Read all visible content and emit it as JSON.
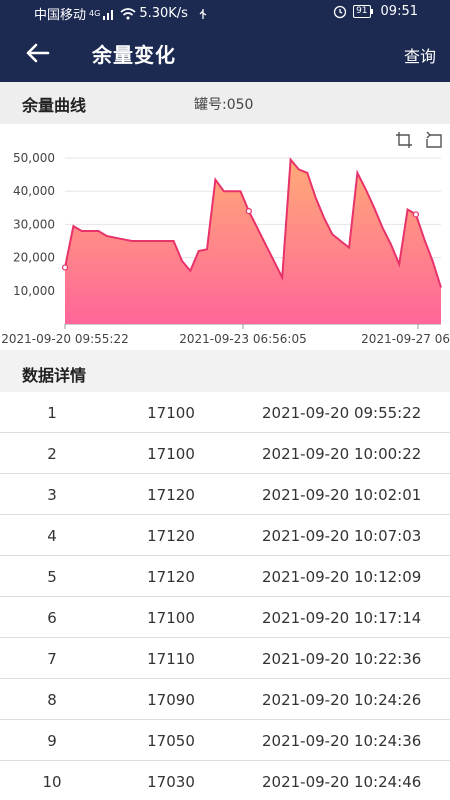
{
  "status_bar": {
    "carrier": "中国移动",
    "network": "4G",
    "speed": "5.30K/s",
    "battery": "91",
    "time": "09:51"
  },
  "header": {
    "back_icon": "arrow-left-icon",
    "title": "余量变化",
    "query_label": "查询"
  },
  "subheader": {
    "label": "余量曲线",
    "tank_label": "罐号:050"
  },
  "chart_data": {
    "type": "area",
    "title": "",
    "xlabel": "",
    "ylabel": "",
    "ylim": [
      0,
      50000
    ],
    "yticks": [
      "10,000",
      "20,000",
      "30,000",
      "40,000",
      "50,000"
    ],
    "xticks": [
      "2021-09-20 09:55:22",
      "2021-09-23 06:56:05",
      "2021-09-27 06"
    ],
    "grid": true,
    "fill_gradient": [
      "#ffaa77",
      "#ff6699"
    ],
    "line_color": "#e8326a",
    "series": [
      {
        "values": [
          17000,
          29500,
          28000,
          28000,
          28000,
          26500,
          26000,
          25500,
          25000,
          25000,
          25000,
          25000,
          25000,
          25000,
          19000,
          16000,
          22000,
          22500,
          43500,
          40000,
          40000,
          40000,
          34000,
          29000,
          24000,
          19000,
          14000,
          49500,
          46500,
          45500,
          38000,
          32000,
          27000,
          25000,
          23000,
          45500,
          40500,
          35000,
          29000,
          24000,
          18000,
          34500,
          33000,
          25500,
          19000,
          11000
        ]
      }
    ]
  },
  "chart_tools": {
    "zoom_icon": "crop-zoom-icon",
    "reset_icon": "restore-icon"
  },
  "section": {
    "title": "数据详情"
  },
  "table": {
    "rows": [
      {
        "idx": "1",
        "value": "17100",
        "time": "2021-09-20 09:55:22"
      },
      {
        "idx": "2",
        "value": "17100",
        "time": "2021-09-20 10:00:22"
      },
      {
        "idx": "3",
        "value": "17120",
        "time": "2021-09-20 10:02:01"
      },
      {
        "idx": "4",
        "value": "17120",
        "time": "2021-09-20 10:07:03"
      },
      {
        "idx": "5",
        "value": "17120",
        "time": "2021-09-20 10:12:09"
      },
      {
        "idx": "6",
        "value": "17100",
        "time": "2021-09-20 10:17:14"
      },
      {
        "idx": "7",
        "value": "17110",
        "time": "2021-09-20 10:22:36"
      },
      {
        "idx": "8",
        "value": "17090",
        "time": "2021-09-20 10:24:26"
      },
      {
        "idx": "9",
        "value": "17050",
        "time": "2021-09-20 10:24:36"
      },
      {
        "idx": "10",
        "value": "17030",
        "time": "2021-09-20 10:24:46"
      }
    ]
  }
}
